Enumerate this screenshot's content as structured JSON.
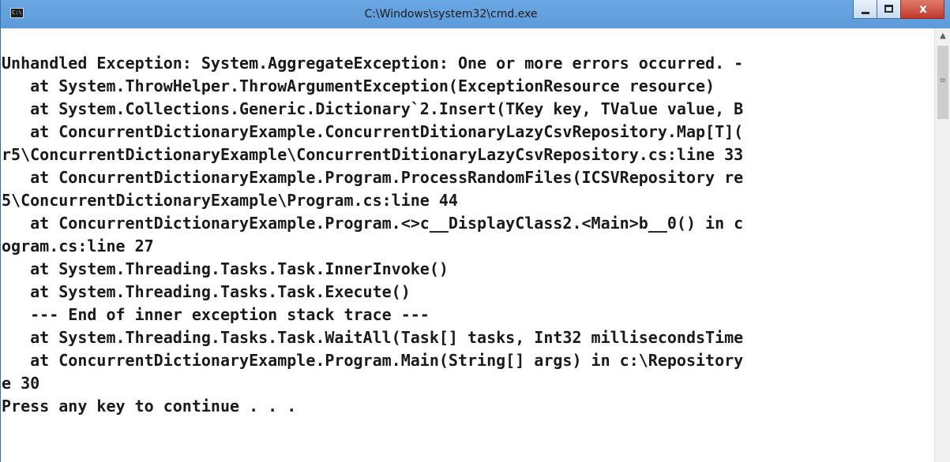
{
  "window": {
    "title": "C:\\Windows\\system32\\cmd.exe",
    "icon": "cmd-icon",
    "icon_text": "C:\\",
    "controls": {
      "minimize": "minimize-icon",
      "maximize": "maximize-icon",
      "close_label": "x"
    }
  },
  "console": {
    "lines": [
      "Unhandled Exception: System.AggregateException: One or more errors occurred. -",
      "   at System.ThrowHelper.ThrowArgumentException(ExceptionResource resource)",
      "   at System.Collections.Generic.Dictionary`2.Insert(TKey key, TValue value, B",
      "   at ConcurrentDictionaryExample.ConcurrentDitionaryLazyCsvRepository.Map[T](",
      "r5\\ConcurrentDictionaryExample\\ConcurrentDitionaryLazyCsvRepository.cs:line 33",
      "   at ConcurrentDictionaryExample.Program.ProcessRandomFiles(ICSVRepository re",
      "5\\ConcurrentDictionaryExample\\Program.cs:line 44",
      "   at ConcurrentDictionaryExample.Program.<>c__DisplayClass2.<Main>b__0() in c",
      "ogram.cs:line 27",
      "   at System.Threading.Tasks.Task.InnerInvoke()",
      "   at System.Threading.Tasks.Task.Execute()",
      "   --- End of inner exception stack trace ---",
      "   at System.Threading.Tasks.Task.WaitAll(Task[] tasks, Int32 millisecondsTime",
      "   at ConcurrentDictionaryExample.Program.Main(String[] args) in c:\\Repository",
      "e 30",
      "Press any key to continue . . ."
    ]
  },
  "scrollbar": {
    "up_arrow": "▲",
    "grip": "≡"
  },
  "colors": {
    "titlebar": "#62a0e0",
    "console_bg": "#ffffff",
    "console_text": "#1a1a1a",
    "close_button": "#c0392b"
  }
}
